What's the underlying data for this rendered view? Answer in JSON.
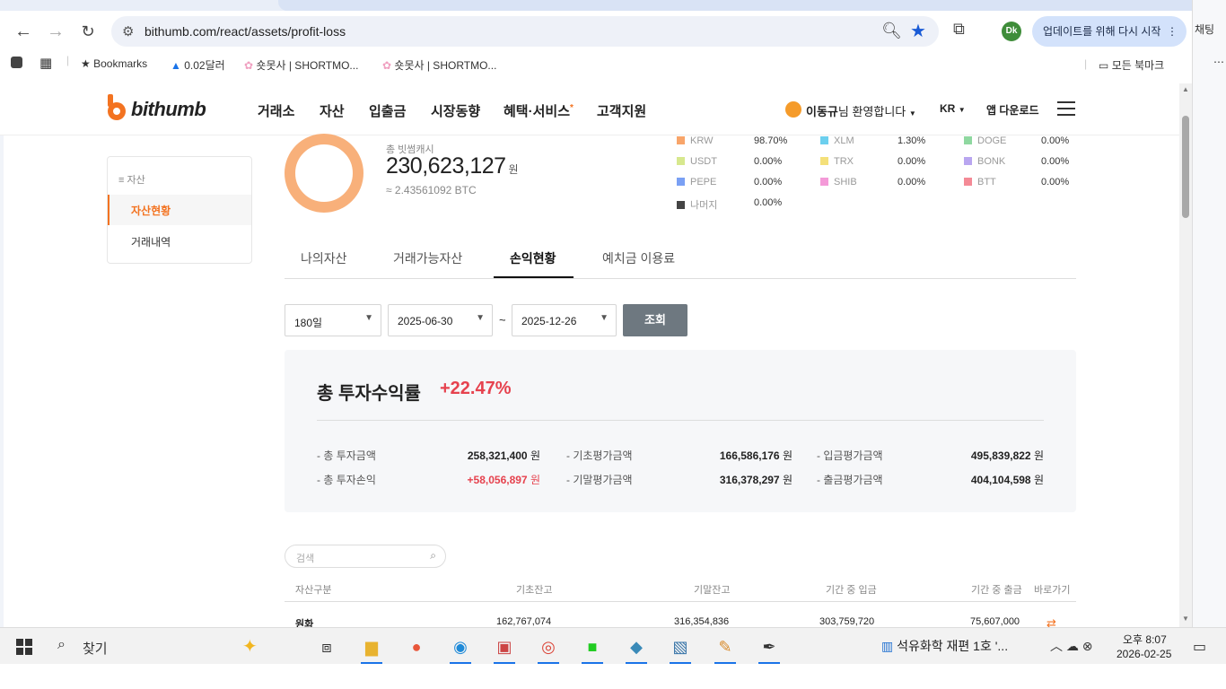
{
  "browser": {
    "url": "bithumb.com/react/assets/profit-loss",
    "update_button": "업데이트를 위해 다시 시작",
    "profile_initials": "Dk",
    "bookmarks": [
      "Bookmarks",
      "0.02달러",
      "숏못사 | SHORTMO...",
      "숏못사 | SHORTMO..."
    ],
    "all_bookmarks": "모든 북마크",
    "side_panel_label": "채팅"
  },
  "header": {
    "logo": "bithumb",
    "nav": [
      "거래소",
      "자산",
      "입출금",
      "시장동향",
      "혜택·서비스",
      "고객지원"
    ],
    "user_name": "이동규",
    "user_greeting": "님 환영합니다",
    "lang": "KR",
    "app_download": "앱 다운로드"
  },
  "sidebar": {
    "title": "자산",
    "items": [
      "자산현황",
      "거래내역"
    ]
  },
  "overview": {
    "cash_label": "총 빗썸캐시",
    "cash_amount": "230,623,127",
    "cash_unit": "원",
    "btc_equiv": "≈ 2.43561092 BTC",
    "donut_color": "#f8b07a",
    "legend": [
      {
        "name": "KRW",
        "pct": "98.70%",
        "color": "#f8a56a"
      },
      {
        "name": "XLM",
        "pct": "1.30%",
        "color": "#6ccfee"
      },
      {
        "name": "DOGE",
        "pct": "0.00%",
        "color": "#8fd8a0"
      },
      {
        "name": "USDT",
        "pct": "0.00%",
        "color": "#d7e88e"
      },
      {
        "name": "TRX",
        "pct": "0.00%",
        "color": "#f4e07a"
      },
      {
        "name": "BONK",
        "pct": "0.00%",
        "color": "#b9a6f0"
      },
      {
        "name": "PEPE",
        "pct": "0.00%",
        "color": "#7aa0f4"
      },
      {
        "name": "SHIB",
        "pct": "0.00%",
        "color": "#f49ad8"
      },
      {
        "name": "BTT",
        "pct": "0.00%",
        "color": "#f48a96"
      },
      {
        "name": "나머지",
        "pct": "0.00%",
        "color": "#444444"
      }
    ]
  },
  "tabs": [
    "나의자산",
    "거래가능자산",
    "손익현황",
    "예치금 이용료"
  ],
  "filters": {
    "period": "180일",
    "start_date": "2025-06-30",
    "separator": "~",
    "end_date": "2025-12-26",
    "search_label": "조회"
  },
  "summary": {
    "title": "총 투자수익률",
    "rate": "+22.47%",
    "rows": [
      {
        "label": "- 총 투자금액",
        "value": "258,321,400",
        "unit": "원"
      },
      {
        "label": "- 총 투자손익",
        "value": "+58,056,897",
        "unit": "원"
      },
      {
        "label": "- 기초평가금액",
        "value": "166,586,176",
        "unit": "원"
      },
      {
        "label": "- 기말평가금액",
        "value": "316,378,297",
        "unit": "원"
      },
      {
        "label": "- 입금평가금액",
        "value": "495,839,822",
        "unit": "원"
      },
      {
        "label": "- 출금평가금액",
        "value": "404,104,598",
        "unit": "원"
      }
    ]
  },
  "table": {
    "search_placeholder": "검색",
    "headers": [
      "자산구분",
      "기초잔고",
      "기말잔고",
      "기간 중 입금",
      "기간 중 출금",
      "바로가기"
    ],
    "rows": [
      {
        "asset": "원화",
        "start": "162,767,074",
        "end": "316,354,836",
        "in": "303,759,720",
        "out": "75,607,000"
      }
    ]
  },
  "taskbar": {
    "search_label": "찾기",
    "tray_app": "석유화학 재편 1호 '...",
    "time": "오후 8:07",
    "date": "2026-02-25"
  }
}
